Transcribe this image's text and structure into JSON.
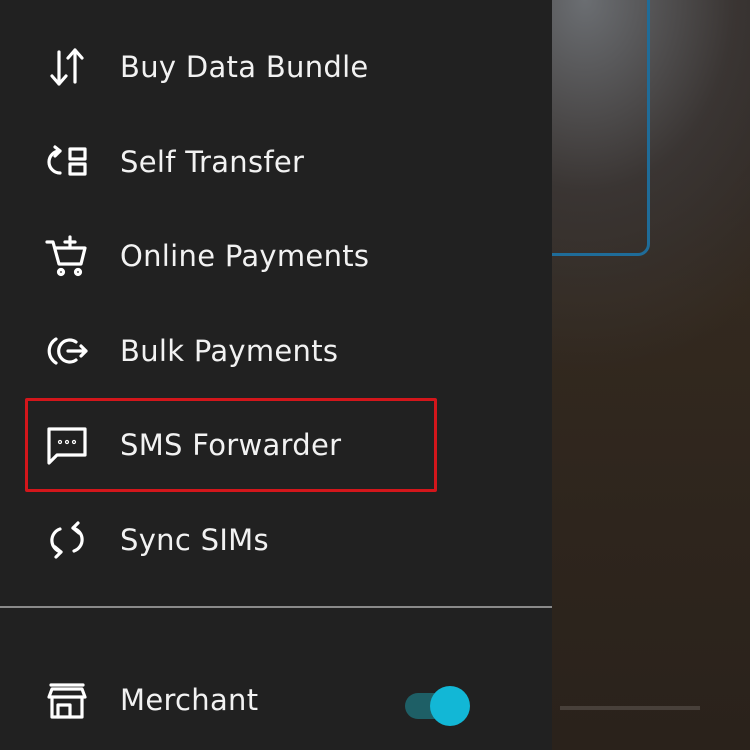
{
  "menu": {
    "items": [
      {
        "label": "Buy Data Bundle",
        "icon": "swap-vertical-icon"
      },
      {
        "label": "Self Transfer",
        "icon": "self-transfer-icon"
      },
      {
        "label": "Online Payments",
        "icon": "cart-add-icon"
      },
      {
        "label": "Bulk Payments",
        "icon": "bulk-payment-icon"
      },
      {
        "label": "SMS Forwarder",
        "icon": "message-dots-icon"
      },
      {
        "label": "Sync SIMs",
        "icon": "sync-icon"
      }
    ],
    "highlighted_item": "SMS Forwarder"
  },
  "merchant": {
    "label": "Merchant",
    "icon": "store-icon",
    "toggle_on": true
  },
  "colors": {
    "drawer_bg": "#212121",
    "highlight_border": "#d3161b",
    "toggle_thumb": "#12b7d6",
    "toggle_track": "#1e5f66",
    "text": "#f2f2f2"
  }
}
